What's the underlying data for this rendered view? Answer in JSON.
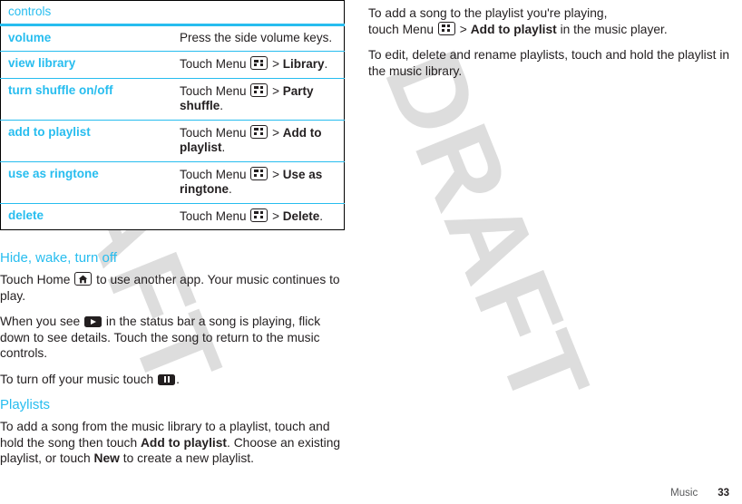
{
  "watermark": {
    "text": "DRAFT"
  },
  "table": {
    "header_label": "controls",
    "rows": [
      {
        "label": "volume",
        "desc_pre": "Press the side volume keys.",
        "has_menu_icon": false,
        "desc_bold": "",
        "desc_post": ""
      },
      {
        "label": "view library",
        "desc_pre": "Touch Menu",
        "has_menu_icon": true,
        "desc_mid": ">",
        "desc_bold": "Library",
        "desc_post": "."
      },
      {
        "label": "turn shuffle on/off",
        "desc_pre": "Touch Menu",
        "has_menu_icon": true,
        "desc_mid": ">",
        "desc_bold": "Party shuffle",
        "desc_post": "."
      },
      {
        "label": "add to playlist",
        "desc_pre": "Touch Menu",
        "has_menu_icon": true,
        "desc_mid": ">",
        "desc_bold": "Add to playlist",
        "desc_post": "."
      },
      {
        "label": "use as ringtone",
        "desc_pre": "Touch Menu",
        "has_menu_icon": true,
        "desc_mid": ">",
        "desc_bold": "Use as ringtone",
        "desc_post": "."
      },
      {
        "label": "delete",
        "desc_pre": "Touch Menu",
        "has_menu_icon": true,
        "desc_mid": ">",
        "desc_bold": "Delete",
        "desc_post": "."
      }
    ]
  },
  "left_column": {
    "section_hide": {
      "heading": "Hide, wake, turn off",
      "p1_a": "Touch Home",
      "p1_b": "to use another app. Your music continues to play.",
      "p2_a": "When you see",
      "p2_b": "in the status bar a song is playing, flick down to see details. Touch the song to return to the music controls.",
      "p3_a": "To turn off your music touch",
      "p3_b": "."
    },
    "section_playlists": {
      "heading": "Playlists",
      "p1_a": "To add a song from the music library to a playlist, touch and hold the song then touch",
      "p1_bold1": "Add to playlist",
      "p1_b": ". Choose an existing playlist, or touch",
      "p1_bold2": "New",
      "p1_c": "to create a new playlist."
    }
  },
  "right_column": {
    "p1_a": "To add a song to the playlist you're playing,",
    "p1_b": "touch Menu",
    "p1_mid": ">",
    "p1_bold": "Add to playlist",
    "p1_c": "in the music player.",
    "p2": "To edit, delete and rename playlists, touch and hold the playlist in the music library."
  },
  "footer": {
    "chapter": "Music",
    "page_number": "33"
  },
  "colors": {
    "accent_cyan": "#27bdef",
    "text": "#231f20",
    "watermark_gray": "#dddddd"
  }
}
